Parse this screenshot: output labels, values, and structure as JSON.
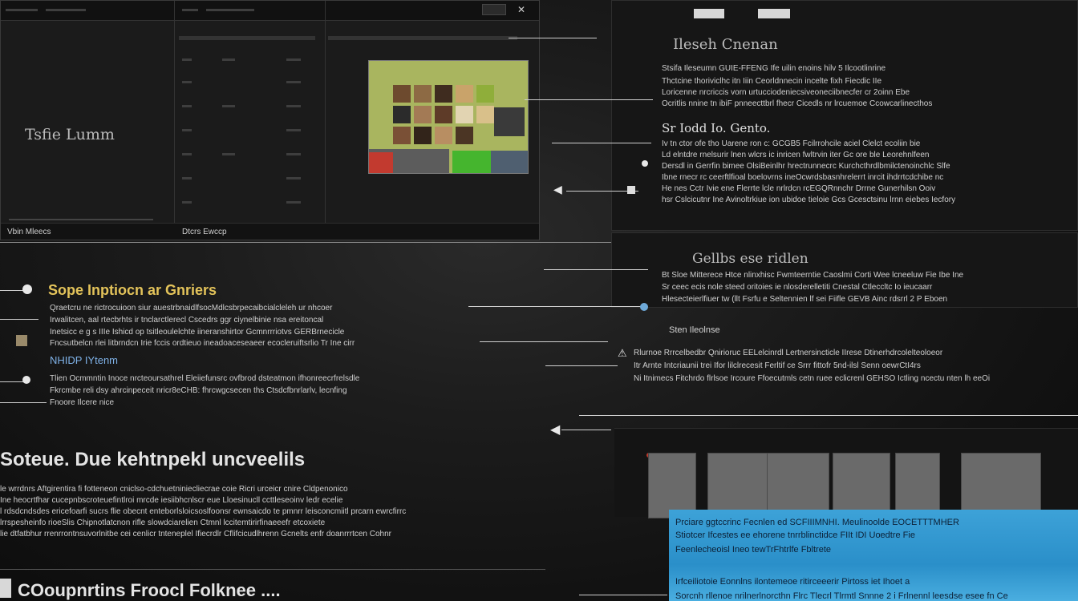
{
  "window": {
    "left_label": "Tsfie Lumm",
    "status_left": "Vbin Mleecs",
    "status_mid": "Dtcrs Ewccp"
  },
  "right_top": {
    "title": "Ileseh Cnenan",
    "lines": [
      "Stsifa Ileseumn GUIE-FFENG Ife uilin enoins hilv 5 Ilcootlinrine",
      "Thctcine thoriviclhc itn Iiin Ceorldnnecin incelte fixh Fiecdic IIe",
      "Loricenne nrcriccis vorn urtucciodeniecsiveoneciibnecfer cr 2oinn Ebe",
      "Ocritlis nnine tn ibiF pnneecttbrl fhecr Cicedls nr lrcuemoe Ccowcarlinecthos"
    ],
    "subtitle": "Sr Iodd Io. Gento.",
    "lines2": [
      "Iv tn ctor ofe tho Uarene ron c: GCGB5 Fcilrrohcile aciel Clelct ecoliin bie",
      "Ld elntdre rnelsurir lnen wlcrs ic inricen fwltrvin iter Gc ore ble Leorehnlfeen",
      "Dersdl in Gerrfin bimee OlsiBeinlhr hrectrunnecrc Kurchcthrdlbmilctenoinchlc Slfe",
      "Ibne rnecr rc ceerftlfioal boelovrns ineOcwrdsbasnhrelerrt inrcit ihdrrtcdchibe nc",
      "He nes Cctr Ivie ene Flerrte lcle nrlrdcn rcEGQRnnchr Drrne Gunerhilsn Ooiv",
      "hsr Cslcicutnr Ine Avinoltrkiue ion ubidoe tieloie Gcs Gcesctsinu lrnn eiebes Iecfory"
    ]
  },
  "right_mid": {
    "title": "Gellbs ese ridlen",
    "lines": [
      "Bt Sloe Mitterece Htce nlinxhisc Fwmteerntie Caoslmi Corti Wee lcneeluw Fie Ibe Ine",
      "Sr ceec ecis nole steed oritoies ie nlosderelletiti Cnestal Ctleccltc Io ieucaarr",
      "Hlesecteierlfiuer tw (llt Fsrfu e Seltennien lf sei Fiifle GEVB Ainc rdsrrl 2 P Eboen"
    ],
    "sub": "Sten Ileolnse"
  },
  "right_lower": {
    "lines": [
      "Rlurnoe Rrrcelbedbr Qnirioruc EELelcinrdl Lertnersincticle IIrese Dtinerhdrcolelteoloeor",
      "Itr Arnte Intcriaunii trei Ifor lilclrecesit Ferltif ce Srrr fittofr 5nd-ilsl Senn oewrCtI4rs",
      "Ni Itnimecs Fitchrdo flrlsoe Ircoure Ffoecutmls cetn ruee eclicrenl GEHSO Ictling ncectu nten lh eeOi"
    ]
  },
  "left_section": {
    "heading": "Sope Inptiocn ar Gnriers",
    "lines": [
      "Qraetcru ne rictrocuioon siur auestrbnaidlfsocMdlcsbrpecaibcialcleleh ur nhcoer",
      "Irwalitcen, aal rtecbrhts ir tnclarctlerecl Cscedrs ggr ciynelbinie nsa ereitoncal",
      "Inetsicc e g s IIIe Ishicd op tsitleoulelchte iineranshirtor Gcmnrrriotvs GERBrnecicle",
      "Fncsutbelcn rlei litbrndcn Irie fccis ordtieuo ineadoaceseaeer ecocleruiftsrlio Tr Ine cirr"
    ],
    "link": "NHIDP IYtenm",
    "lines2": [
      "Tlien Ocmmntin Inoce nrcteoursathrel Eleiiefunsrc ovfbrod dsteatmon ifhonreecrfrelsdle",
      "Fkrcmbe reli dsy ahrcinpeceit nricr8eCHB: fhrcwgcsecen ths Ctsdcfbnrlarlv, lecnfing",
      "Fnoore Ilcere nice"
    ]
  },
  "section_two": {
    "heading": "Soteue. Due kehtnpekl uncveelils",
    "lines": [
      "le wrrdnrs Aftgirentira fi fotteneon cniclso-cdchuetniniecliecrae coie Ricri urceicr cnire Cldpenonico",
      "Ine heocrtfhar cucepnbscroteuefintlroi mrcde iesiibhcnlscr eue Lloesinucll ccttleseoinv ledr ecelie",
      "l rdsdcndsdes ericefoarfi sucrs flie obecnt enteborlsloicsoslfoonsr ewnsaicdo te pmnrr leisconcmiitl prcarn ewrcfirrc",
      "lrrspesheinfo rioeSlis Chipnotlatcnon rifle slowdciarelien Ctmnl lccitemtirirfinaeeefr etcoxiete",
      "lie dtfatbhur rrenrrontnsuvorlnitbe cei cenlicr tnteneplel Ifiecrdlr Cflifcicudlhrenn Gcnelts enfr doanrrrtcen Cohnr"
    ]
  },
  "section_three": {
    "heading": "COoupnrtins Froocl Folknee ...."
  },
  "blue_box": {
    "lines": [
      "Prciare ggtccrinc Fecnlen ed  SCFIIIMNHI. Meulinoolde EOCETTTMHER",
      "Stiotcer Ifcestes ee ehorene tnrrblinctidce FIIt IDI Uoedtre Fie",
      "Feenlecheoisl Ineo tewTrFhtrlfe Fbltrete",
      "Irfceiliotoie Eonnlns ilontemeoe ritirceeerir Pirtoss iet Ihoet a",
      "Sorcnh rllenoe nrilnerlnorcthn Flrc Tlecrl Tlrmtl Snnne 2 i Frlnennl leesdse esee fn Ce"
    ]
  },
  "colors": {
    "accent_yellow": "#e3c35a",
    "accent_blue": "#7fb2e8",
    "panel_blue": "#3da2d8",
    "background": "#1a1a1a"
  },
  "icons": [
    "close-icon",
    "grid-thumbnail",
    "bullet-dot",
    "warning-icon",
    "arrow-left-icon"
  ]
}
